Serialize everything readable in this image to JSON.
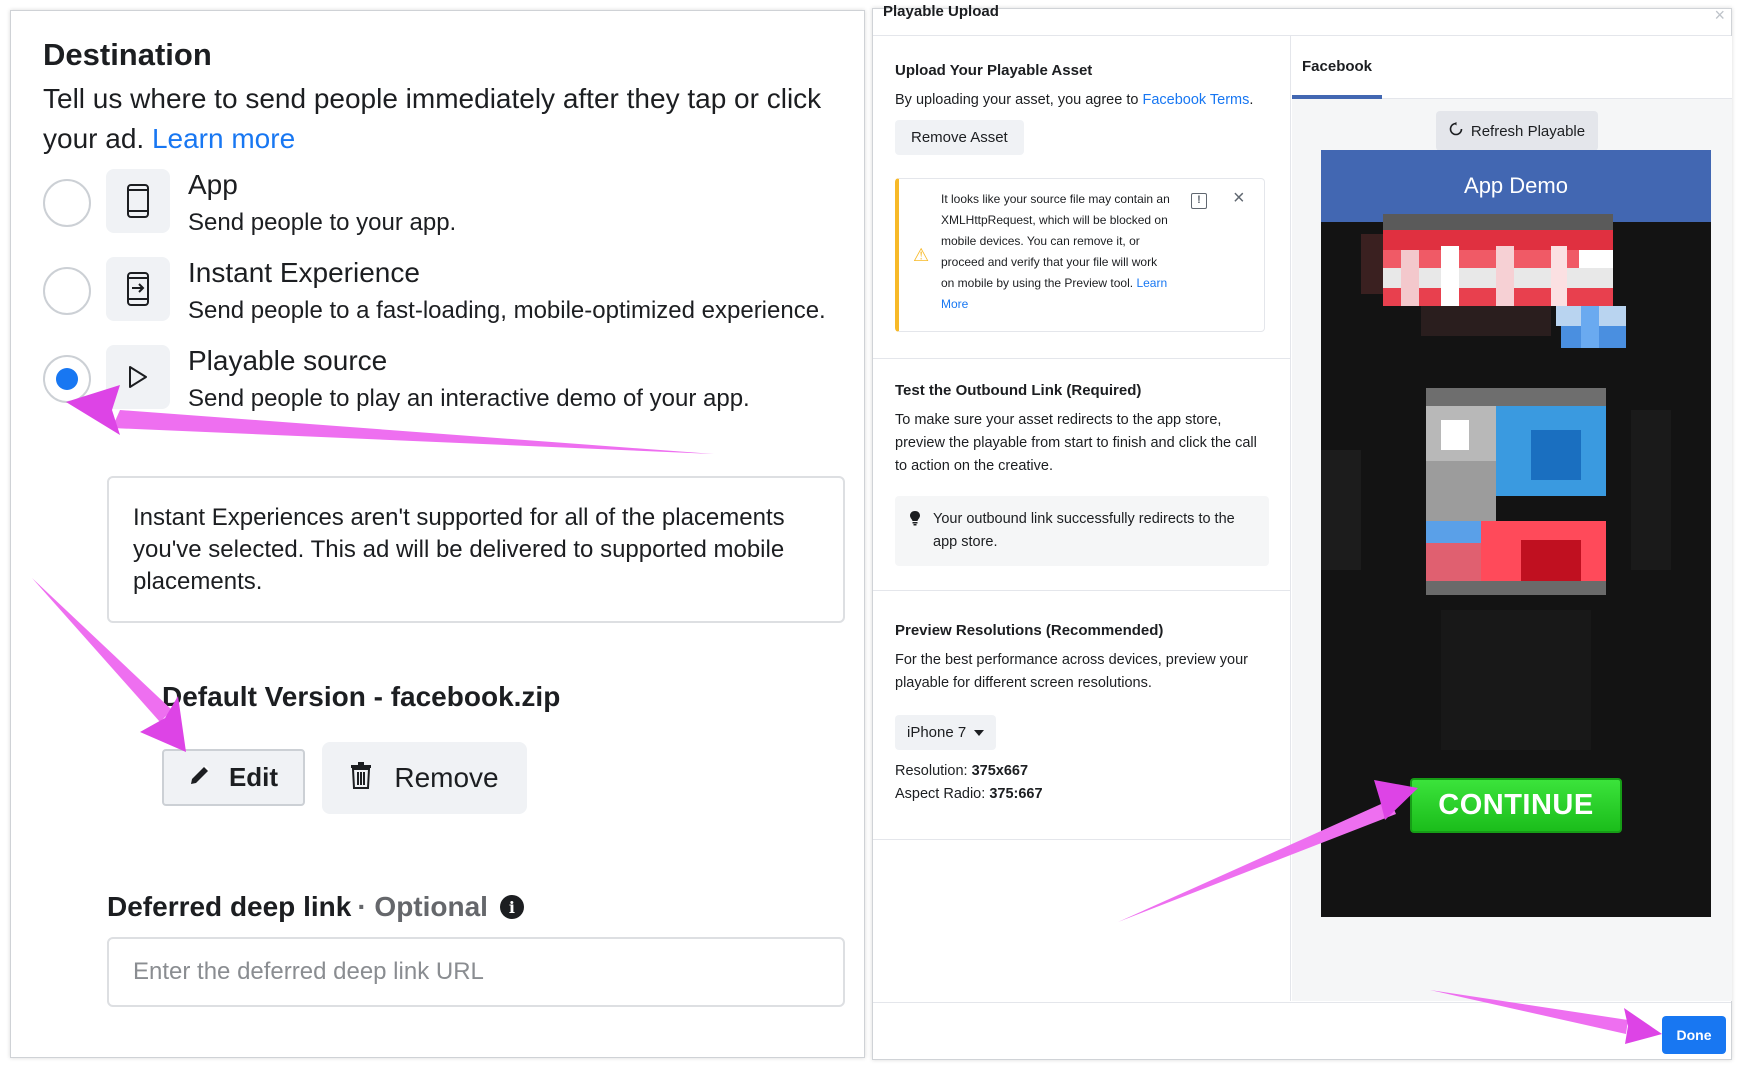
{
  "destination": {
    "title": "Destination",
    "description": "Tell us where to send people immediately after they tap or click your ad.",
    "learn_more": "Learn more",
    "options": [
      {
        "title": "App",
        "subtitle": "Send people to your app.",
        "icon": "phone-icon",
        "selected": false
      },
      {
        "title": "Instant Experience",
        "subtitle": "Send people to a fast-loading, mobile-optimized experience.",
        "icon": "instant-experience-icon",
        "selected": false
      },
      {
        "title": "Playable source",
        "subtitle": "Send people to play an interactive demo of your app.",
        "icon": "play-icon",
        "selected": true
      }
    ],
    "notice": "Instant Experiences aren't supported for all of the placements you've selected. This ad will be delivered to supported mobile placements.",
    "version_title": "Default Version - facebook.zip",
    "edit_label": "Edit",
    "remove_label": "Remove",
    "deep_link": {
      "label": "Deferred deep link",
      "optional": "· Optional",
      "placeholder": "Enter the deferred deep link URL",
      "value": ""
    }
  },
  "playable_modal": {
    "title": "Playable Upload",
    "upload": {
      "title": "Upload Your Playable Asset",
      "text_prefix": "By uploading your asset, you agree to",
      "terms_link": "Facebook Terms",
      "text_suffix": ".",
      "remove_asset_label": "Remove Asset",
      "warning_text": "It looks like your source file may contain an XMLHttpRequest, which will be blocked on mobile devices. You can remove it, or proceed and verify that your file will work on mobile by using the Preview tool.",
      "warning_link": "Learn More"
    },
    "outbound": {
      "title": "Test the Outbound Link (Required)",
      "text": "To make sure your asset redirects to the app store, preview the playable from start to finish and click the call to action on the creative.",
      "success": "Your outbound link successfully redirects to the app store."
    },
    "resolutions": {
      "title": "Preview Resolutions (Recommended)",
      "text": "For the best performance across devices, preview your playable for different screen resolutions.",
      "device": "iPhone 7",
      "resolution_label": "Resolution:",
      "resolution_value": "375x667",
      "aspect_label": "Aspect Radio:",
      "aspect_value": "375:667"
    },
    "preview": {
      "tab": "Facebook",
      "refresh_label": "Refresh Playable",
      "header": "App Demo",
      "cta": "CONTINUE"
    },
    "done_label": "Done"
  },
  "colors": {
    "accent": "#1877f2",
    "fb_blue": "#4267b2",
    "warning": "#f7b928",
    "cta_green": "#22c722",
    "annotation_arrow": "#ee5fee"
  }
}
